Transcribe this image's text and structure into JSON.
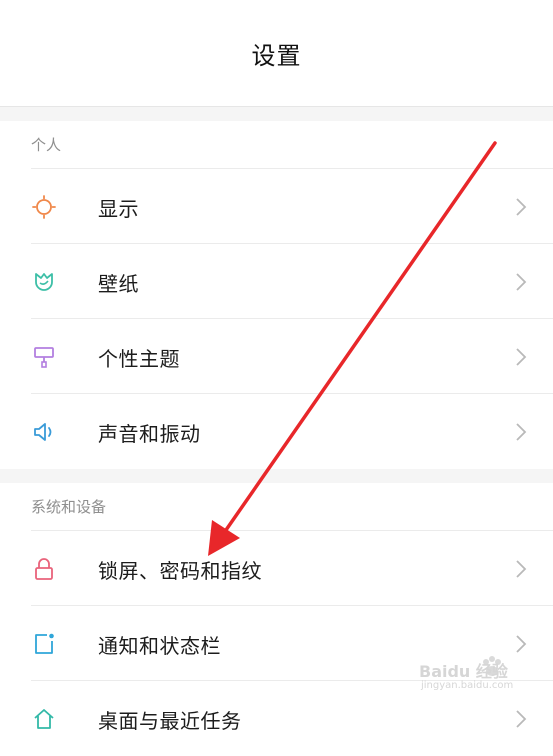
{
  "header": {
    "title": "设置"
  },
  "sections": [
    {
      "label": "个人",
      "items": [
        {
          "label": "显示",
          "icon": "sun-icon",
          "color": "#f0884a"
        },
        {
          "label": "壁纸",
          "icon": "tulip-icon",
          "color": "#3dbfa7"
        },
        {
          "label": "个性主题",
          "icon": "paint-roller-icon",
          "color": "#b37fe0"
        },
        {
          "label": "声音和振动",
          "icon": "speaker-icon",
          "color": "#3a9bd8"
        }
      ]
    },
    {
      "label": "系统和设备",
      "items": [
        {
          "label": "锁屏、密码和指纹",
          "icon": "lock-icon",
          "color": "#e9637b"
        },
        {
          "label": "通知和状态栏",
          "icon": "notification-icon",
          "color": "#2fa6d9"
        },
        {
          "label": "桌面与最近任务",
          "icon": "home-icon",
          "color": "#33b9a8"
        }
      ]
    }
  ],
  "watermark": {
    "brand": "Baidu 经验",
    "url": "jingyan.baidu.com"
  },
  "annotation": {
    "color": "#e8272a"
  }
}
